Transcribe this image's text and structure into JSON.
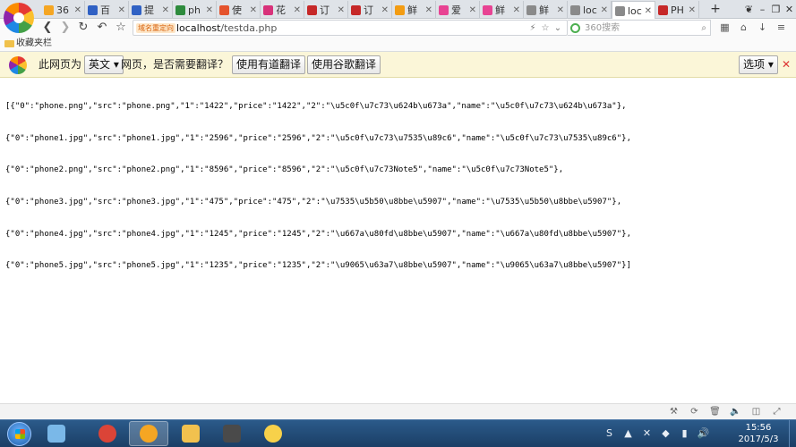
{
  "browser": {
    "tabs": [
      {
        "label": "36",
        "icon_color": "#f5a623"
      },
      {
        "label": "百",
        "icon_color": "#3061c4"
      },
      {
        "label": "提",
        "icon_color": "#3061c4"
      },
      {
        "label": "ph",
        "icon_color": "#2e8b3d"
      },
      {
        "label": "使",
        "icon_color": "#e5532d"
      },
      {
        "label": "花",
        "icon_color": "#d8327a"
      },
      {
        "label": "订",
        "icon_color": "#c62828"
      },
      {
        "label": "订",
        "icon_color": "#c62828"
      },
      {
        "label": "鲜",
        "icon_color": "#f39c12"
      },
      {
        "label": "爱",
        "icon_color": "#e84393"
      },
      {
        "label": "鲜",
        "icon_color": "#e84393"
      },
      {
        "label": "鲜",
        "icon_color": "#8a8a8a"
      },
      {
        "label": "loc",
        "icon_color": "#8a8a8a"
      },
      {
        "label": "loc",
        "icon_color": "#8a8a8a"
      },
      {
        "label": "PH",
        "icon_color": "#c62828"
      }
    ],
    "active_tab_index": 13,
    "tab_close_glyph": "✕",
    "new_tab_glyph": "+",
    "window_controls": [
      "❦",
      "–",
      "❐",
      "✕"
    ]
  },
  "navigation": {
    "back_glyph": "❮",
    "forward_glyph": "❯",
    "reload_glyph": "↻",
    "undo_glyph": "↶",
    "star_glyph": "☆",
    "redirect_badge": "域名重定向",
    "url_host": "localhost",
    "url_path": "/testda.php",
    "url_icons": [
      "⚡",
      "☆",
      "⌄"
    ],
    "search_placeholder": "360搜索",
    "search_glyph": "⌕",
    "right_tools": [
      "▦",
      "⌂",
      "↓",
      "≡"
    ]
  },
  "bookmarks": {
    "label": "收藏夹栏"
  },
  "translate_bar": {
    "prefix": "此网页为",
    "language": "英文",
    "suffix": "网页，是否需要翻译？",
    "youdao_button": "使用有道翻译",
    "google_button": "使用谷歌翻译",
    "options_button": "选项",
    "close_glyph": "✕"
  },
  "page": {
    "lines": [
      "[{\"0\":\"phone.png\",\"src\":\"phone.png\",\"1\":\"1422\",\"price\":\"1422\",\"2\":\"\\u5c0f\\u7c73\\u624b\\u673a\",\"name\":\"\\u5c0f\\u7c73\\u624b\\u673a\"},",
      "{\"0\":\"phone1.jpg\",\"src\":\"phone1.jpg\",\"1\":\"2596\",\"price\":\"2596\",\"2\":\"\\u5c0f\\u7c73\\u7535\\u89c6\",\"name\":\"\\u5c0f\\u7c73\\u7535\\u89c6\"},",
      "{\"0\":\"phone2.png\",\"src\":\"phone2.png\",\"1\":\"8596\",\"price\":\"8596\",\"2\":\"\\u5c0f\\u7c73Note5\",\"name\":\"\\u5c0f\\u7c73Note5\"},",
      "{\"0\":\"phone3.jpg\",\"src\":\"phone3.jpg\",\"1\":\"475\",\"price\":\"475\",\"2\":\"\\u7535\\u5b50\\u8bbe\\u5907\",\"name\":\"\\u7535\\u5b50\\u8bbe\\u5907\"},",
      "{\"0\":\"phone4.jpg\",\"src\":\"phone4.jpg\",\"1\":\"1245\",\"price\":\"1245\",\"2\":\"\\u667a\\u80fd\\u8bbe\\u5907\",\"name\":\"\\u667a\\u80fd\\u8bbe\\u5907\"},",
      "{\"0\":\"phone5.jpg\",\"src\":\"phone5.jpg\",\"1\":\"1235\",\"price\":\"1235\",\"2\":\"\\u9065\\u63a7\\u8bbe\\u5907\",\"name\":\"\\u9065\\u63a7\\u8bbe\\u5907\"}]"
    ]
  },
  "status_bar": {
    "icons": [
      "⚒",
      "⟳",
      "🗑",
      "🔈",
      "◫",
      "⤢"
    ]
  },
  "taskbar": {
    "apps": [
      {
        "name": "pinwheel",
        "color": "#7ab8e8"
      },
      {
        "name": "chrome",
        "color": "#db4437"
      },
      {
        "name": "360-browser",
        "color": "#f5a623"
      },
      {
        "name": "explorer",
        "color": "#f2c14e"
      },
      {
        "name": "sublime",
        "color": "#4a4a4a"
      },
      {
        "name": "lemon",
        "color": "#f7d14a"
      }
    ],
    "tray_icons": [
      "S",
      "▲",
      "✕",
      "◆",
      "▮",
      "🔊"
    ],
    "time": "15:56",
    "date": "2017/5/3"
  }
}
